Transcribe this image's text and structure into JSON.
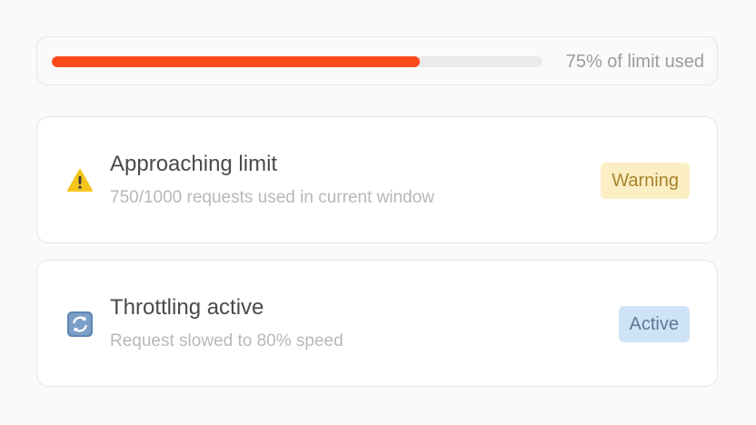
{
  "usage": {
    "percent": 75,
    "label": "75% of limit used",
    "fill_color": "#fc4a1a",
    "track_color": "#ebebeb"
  },
  "alerts": [
    {
      "icon": "warning-triangle-icon",
      "title": "Approaching limit",
      "subtitle": "750/1000 requests used in current window",
      "badge": "Warning",
      "badge_color": "#fbeec3"
    },
    {
      "icon": "refresh-cycle-icon",
      "title": "Throttling active",
      "subtitle": "Request slowed to 80% speed",
      "badge": "Active",
      "badge_color": "#cfe3f6"
    }
  ]
}
